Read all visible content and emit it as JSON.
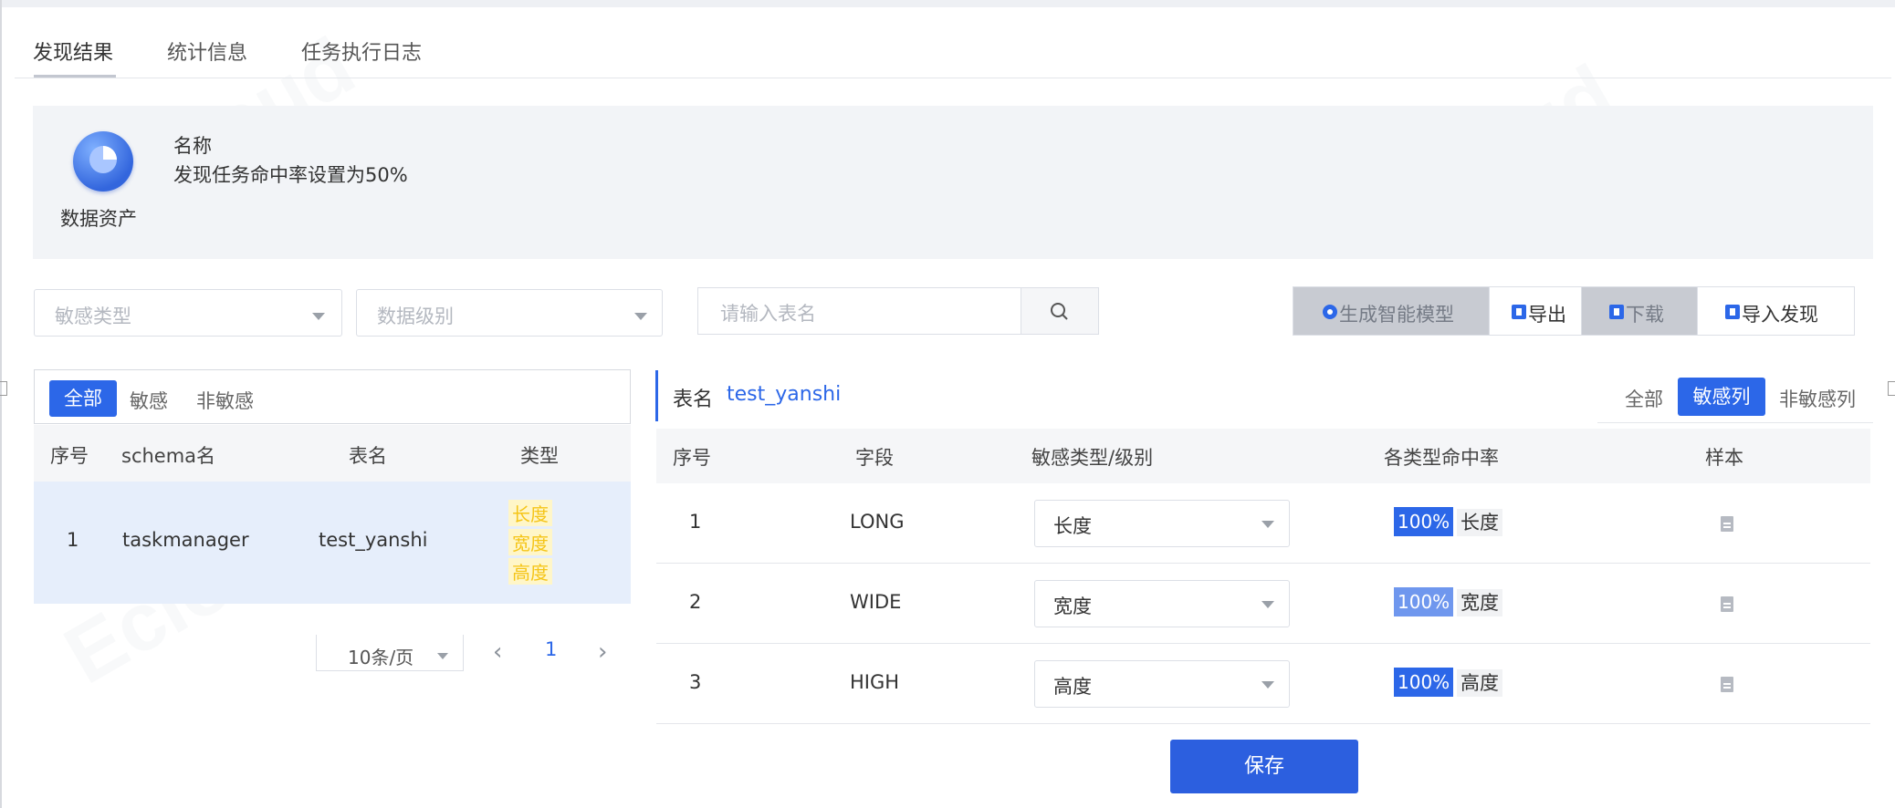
{
  "tabs": [
    {
      "label": "发现结果"
    },
    {
      "label": "统计信息"
    },
    {
      "label": "任务执行日志"
    }
  ],
  "info": {
    "asset_label": "数据资产",
    "name_title": "名称",
    "name_value": "发现任务命中率设置为50%"
  },
  "filters": {
    "sensitive_type_placeholder": "敏感类型",
    "data_level_placeholder": "数据级别",
    "table_search_placeholder": "请输入表名"
  },
  "toolbar": {
    "generate_model": "生成智能模型",
    "export": "导出",
    "download": "下载",
    "import_discovery": "导入发现"
  },
  "left_panel": {
    "segments": [
      "全部",
      "敏感",
      "非敏感"
    ],
    "columns": [
      "序号",
      "schema名",
      "表名",
      "类型"
    ],
    "rows": [
      {
        "index": "1",
        "schema": "taskmanager",
        "table": "test_yanshi",
        "types": [
          "长度",
          "宽度",
          "高度"
        ]
      }
    ],
    "pager": {
      "page_size": "10条/页",
      "current_page": "1"
    }
  },
  "right_panel": {
    "title_label": "表名",
    "title_value": "test_yanshi",
    "segments": [
      "全部",
      "敏感列",
      "非敏感列"
    ],
    "columns": [
      "序号",
      "字段",
      "敏感类型/级别",
      "各类型命中率",
      "样本"
    ],
    "rows": [
      {
        "index": "1",
        "field": "LONG",
        "type": "长度",
        "rate": "100%",
        "rate_label": "长度"
      },
      {
        "index": "2",
        "field": "WIDE",
        "type": "宽度",
        "rate": "100%",
        "rate_label": "宽度"
      },
      {
        "index": "3",
        "field": "HIGH",
        "type": "高度",
        "rate": "100%",
        "rate_label": "高度"
      }
    ],
    "save_label": "保存"
  },
  "colors": {
    "primary": "#2c67e8",
    "tag_yellow": "#f5c518",
    "panel_bg": "#f2f4f7"
  }
}
